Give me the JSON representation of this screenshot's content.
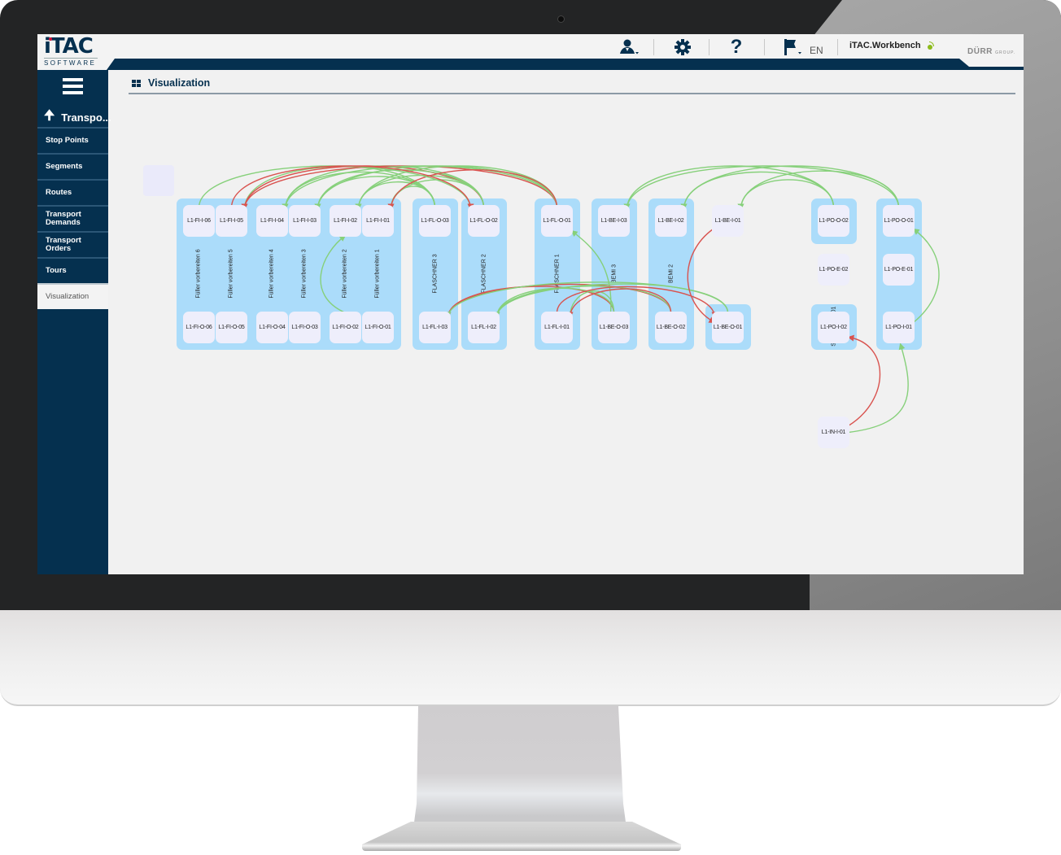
{
  "header": {
    "logo_text": "iTAC",
    "logo_subtext": "SOFTWARE",
    "icons": [
      "user-menu-icon",
      "gear-icon",
      "help-icon",
      "flag-icon"
    ],
    "language": "EN",
    "app_name": "iTAC.Workbench",
    "brand": "DÜRR",
    "brand_sub": "GROUP."
  },
  "sidebar": {
    "back_label": "Transpo...",
    "items": [
      {
        "label": "Stop Points"
      },
      {
        "label": "Segments"
      },
      {
        "label": "Routes"
      },
      {
        "label": "Transport Demands"
      },
      {
        "label": "Transport Orders"
      },
      {
        "label": "Tours"
      },
      {
        "label": "Visualization",
        "active": true
      }
    ]
  },
  "content": {
    "title": "Visualization"
  },
  "diagram": {
    "colors": {
      "group": "#abdcfa",
      "node": "#eeeefb",
      "edge_ok": "#86d07a",
      "edge_error": "#d9534f"
    },
    "groups": [
      {
        "id": "fi",
        "labels": [
          "Füller vorbereiten 6",
          "Füller vorbereiten 5",
          "Füller vorbereiten 4",
          "Füller vorbereiten 3",
          "Füller vorbereiten 2",
          "Füller vorbereiten 1"
        ]
      },
      {
        "id": "fl3",
        "labels": [
          "FLASCHNER 3"
        ]
      },
      {
        "id": "fl2",
        "labels": [
          "FLASCHNER 2"
        ]
      },
      {
        "id": "fl1",
        "labels": [
          "FLASCHNER 1"
        ]
      },
      {
        "id": "be3",
        "labels": [
          "BEMI 3"
        ]
      },
      {
        "id": "be2",
        "labels": [
          "BEMI 2"
        ]
      },
      {
        "id": "po2",
        "labels": [
          "01",
          "S0"
        ]
      },
      {
        "id": "po1",
        "labels": []
      }
    ],
    "nodes": [
      {
        "id": "L1-FI-I-06"
      },
      {
        "id": "L1-FI-I-05"
      },
      {
        "id": "L1-FI-I-04"
      },
      {
        "id": "L1-FI-I-03"
      },
      {
        "id": "L1-FI-I-02"
      },
      {
        "id": "L1-FI-I-01"
      },
      {
        "id": "L1-FI-O-06"
      },
      {
        "id": "L1-FI-O-05"
      },
      {
        "id": "L1-FI-O-04"
      },
      {
        "id": "L1-FI-O-03"
      },
      {
        "id": "L1-FI-O-02"
      },
      {
        "id": "L1-FI-O-01"
      },
      {
        "id": "L1-FL-O-03"
      },
      {
        "id": "L1-FL-O-02"
      },
      {
        "id": "L1-FL-O-01"
      },
      {
        "id": "L1-FL-I-03"
      },
      {
        "id": "L1-FL-I-02"
      },
      {
        "id": "L1-FL-I-01"
      },
      {
        "id": "L1-BE-I-03"
      },
      {
        "id": "L1-BE-I-02"
      },
      {
        "id": "L1-BE-I-01"
      },
      {
        "id": "L1-BE-O-03"
      },
      {
        "id": "L1-BE-O-02"
      },
      {
        "id": "L1-BE-O-01"
      },
      {
        "id": "L1-PO-O-02"
      },
      {
        "id": "L1-PO-E-02"
      },
      {
        "id": "L1-PO-I-02"
      },
      {
        "id": "L1-PO-O-01"
      },
      {
        "id": "L1-PO-E-01"
      },
      {
        "id": "L1-PO-I-01"
      },
      {
        "id": "L1-IN-I-01"
      }
    ],
    "edges": [
      {
        "from": "L1-FL-O-03",
        "to": "L1-FI-I-05",
        "status": "ok"
      },
      {
        "from": "L1-FL-O-03",
        "to": "L1-FI-I-04",
        "status": "ok"
      },
      {
        "from": "L1-FL-O-03",
        "to": "L1-FI-I-03",
        "status": "ok"
      },
      {
        "from": "L1-FL-O-03",
        "to": "L1-FI-I-02",
        "status": "ok"
      },
      {
        "from": "L1-FL-O-03",
        "to": "L1-FI-I-01",
        "status": "ok"
      },
      {
        "from": "L1-FL-O-02",
        "to": "L1-FI-I-05",
        "status": "error"
      },
      {
        "from": "L1-FL-O-02",
        "to": "L1-FI-I-04",
        "status": "ok"
      },
      {
        "from": "L1-FL-O-02",
        "to": "L1-FI-I-03",
        "status": "ok"
      },
      {
        "from": "L1-FL-O-02",
        "to": "L1-FI-I-02",
        "status": "ok"
      },
      {
        "from": "L1-FL-O-02",
        "to": "L1-FI-I-01",
        "status": "ok"
      },
      {
        "from": "L1-FL-O-01",
        "to": "L1-FI-I-05",
        "status": "error"
      },
      {
        "from": "L1-FL-O-01",
        "to": "L1-FI-I-04",
        "status": "ok"
      },
      {
        "from": "L1-FL-O-01",
        "to": "L1-FI-I-03",
        "status": "ok"
      },
      {
        "from": "L1-FL-O-01",
        "to": "L1-FI-I-02",
        "status": "ok"
      },
      {
        "from": "L1-FL-O-01",
        "to": "L1-FI-I-01",
        "status": "error"
      },
      {
        "from": "L1-FI-I-06",
        "to": "L1-FL-O-02",
        "status": "ok"
      },
      {
        "from": "L1-FI-I-05",
        "to": "L1-FL-O-02",
        "status": "error"
      },
      {
        "from": "L1-FI-O-02",
        "to": "L1-FI-I-02",
        "status": "ok"
      },
      {
        "from": "L1-BE-O-03",
        "to": "L1-FL-I-03",
        "status": "error"
      },
      {
        "from": "L1-BE-O-03",
        "to": "L1-FL-I-02",
        "status": "ok"
      },
      {
        "from": "L1-BE-O-03",
        "to": "L1-FL-I-01",
        "status": "ok"
      },
      {
        "from": "L1-BE-O-03",
        "to": "L1-FL-O-01",
        "status": "ok"
      },
      {
        "from": "L1-BE-O-02",
        "to": "L1-FL-I-03",
        "status": "error"
      },
      {
        "from": "L1-BE-O-02",
        "to": "L1-FL-I-02",
        "status": "ok"
      },
      {
        "from": "L1-BE-O-02",
        "to": "L1-FL-I-01",
        "status": "error"
      },
      {
        "from": "L1-BE-O-01",
        "to": "L1-FL-I-03",
        "status": "ok"
      },
      {
        "from": "L1-BE-O-01",
        "to": "L1-FL-I-02",
        "status": "ok"
      },
      {
        "from": "L1-FL-I-01",
        "to": "L1-BE-O-01",
        "status": "error"
      },
      {
        "from": "L1-BE-I-01",
        "to": "L1-BE-O-01",
        "status": "error"
      },
      {
        "from": "L1-PO-O-02",
        "to": "L1-BE-I-03",
        "status": "ok"
      },
      {
        "from": "L1-PO-O-02",
        "to": "L1-BE-I-02",
        "status": "ok"
      },
      {
        "from": "L1-PO-O-02",
        "to": "L1-BE-I-01",
        "status": "ok"
      },
      {
        "from": "L1-PO-O-01",
        "to": "L1-BE-I-03",
        "status": "ok"
      },
      {
        "from": "L1-PO-O-01",
        "to": "L1-BE-I-02",
        "status": "ok"
      },
      {
        "from": "L1-PO-O-01",
        "to": "L1-BE-I-01",
        "status": "ok"
      },
      {
        "from": "L1-PO-I-01",
        "to": "L1-PO-O-01",
        "status": "ok"
      },
      {
        "from": "L1-IN-I-01",
        "to": "L1-PO-I-02",
        "status": "error"
      },
      {
        "from": "L1-IN-I-01",
        "to": "L1-PO-I-01",
        "status": "ok"
      }
    ]
  }
}
